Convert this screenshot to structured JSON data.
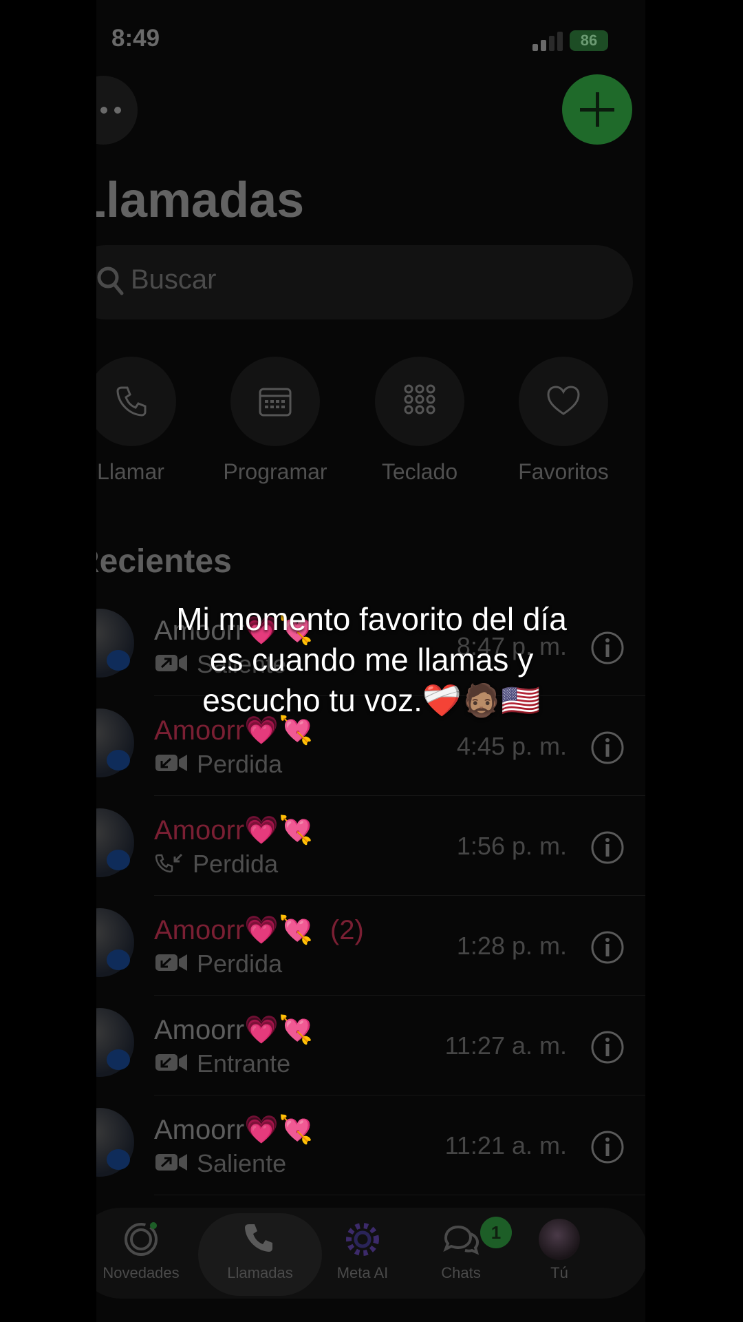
{
  "status": {
    "time": "8:49",
    "battery": "86"
  },
  "header": {
    "title": "Llamadas"
  },
  "search": {
    "placeholder": "Buscar"
  },
  "quick_actions": [
    {
      "label": "Llamar",
      "icon": "phone-icon"
    },
    {
      "label": "Programar",
      "icon": "calendar-icon"
    },
    {
      "label": "Teclado",
      "icon": "keypad-icon"
    },
    {
      "label": "Favoritos",
      "icon": "heart-icon"
    }
  ],
  "recents": {
    "title": "Recientes",
    "calls": [
      {
        "name": "Amoorr💗💘",
        "count": "",
        "type": "Saliente",
        "time": "8:47 p. m.",
        "missed": false,
        "icon": "video-outgoing-icon"
      },
      {
        "name": "Amoorr💗💘",
        "count": "",
        "type": "Perdida",
        "time": "4:45 p. m.",
        "missed": true,
        "icon": "video-missed-icon"
      },
      {
        "name": "Amoorr💗💘",
        "count": "",
        "type": "Perdida",
        "time": "1:56 p. m.",
        "missed": true,
        "icon": "phone-missed-icon"
      },
      {
        "name": "Amoorr💗💘",
        "count": "(2)",
        "type": "Perdida",
        "time": "1:28 p. m.",
        "missed": true,
        "icon": "video-missed-icon"
      },
      {
        "name": "Amoorr💗💘",
        "count": "",
        "type": "Entrante",
        "time": "11:27 a. m.",
        "missed": false,
        "icon": "video-incoming-icon"
      },
      {
        "name": "Amoorr💗💘",
        "count": "",
        "type": "Saliente",
        "time": "11:21 a. m.",
        "missed": false,
        "icon": "video-outgoing-icon"
      }
    ]
  },
  "tabs": [
    {
      "label": "Novedades",
      "icon": "updates-icon"
    },
    {
      "label": "Llamadas",
      "icon": "phone-icon",
      "active": true
    },
    {
      "label": "Meta AI",
      "icon": "meta-ai-icon"
    },
    {
      "label": "Chats",
      "icon": "chats-icon",
      "badge": "1"
    },
    {
      "label": "Tú",
      "icon": "profile-avatar"
    }
  ],
  "caption": {
    "line1": "Mi momento favorito del día",
    "line2": "es cuando me llamas y",
    "line3": "escucho tu voz.❤️‍🩹🧔🏽🇺🇸"
  },
  "colors": {
    "accent": "#25D366",
    "missed": "#7a1f33"
  }
}
